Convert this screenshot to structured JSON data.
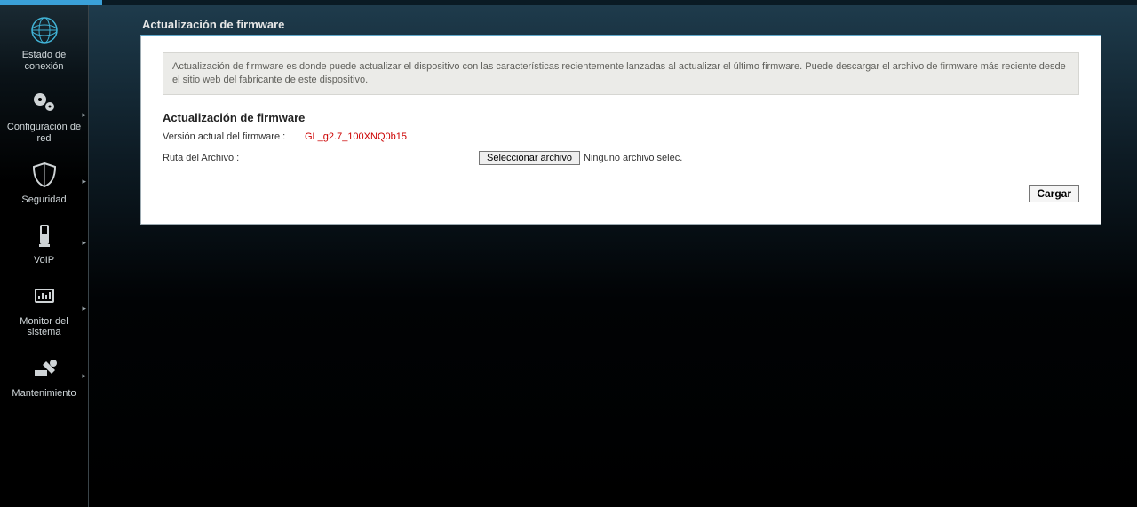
{
  "sidebar": {
    "items": [
      {
        "label": "Estado de conexión",
        "icon": "globe"
      },
      {
        "label": "Configuración de red",
        "icon": "gears"
      },
      {
        "label": "Seguridad",
        "icon": "shield"
      },
      {
        "label": "VoIP",
        "icon": "phone"
      },
      {
        "label": "Monitor del sistema",
        "icon": "monitor"
      },
      {
        "label": "Mantenimiento",
        "icon": "wrench"
      }
    ]
  },
  "page": {
    "title": "Actualización de firmware",
    "info": "Actualización de firmware es donde puede actualizar el dispositivo con las características recientemente lanzadas al actualizar el último firmware. Puede descargar el archivo de firmware más reciente desde el sitio web del fabricante de este dispositivo.",
    "section_title": "Actualización de firmware",
    "version_label": "Versión actual del firmware :",
    "version_value": "GL_g2.7_100XNQ0b15",
    "path_label": "Ruta del Archivo :",
    "choose_file_label": "Seleccionar archivo",
    "file_status": "Ninguno archivo selec.",
    "load_button": "Cargar"
  }
}
